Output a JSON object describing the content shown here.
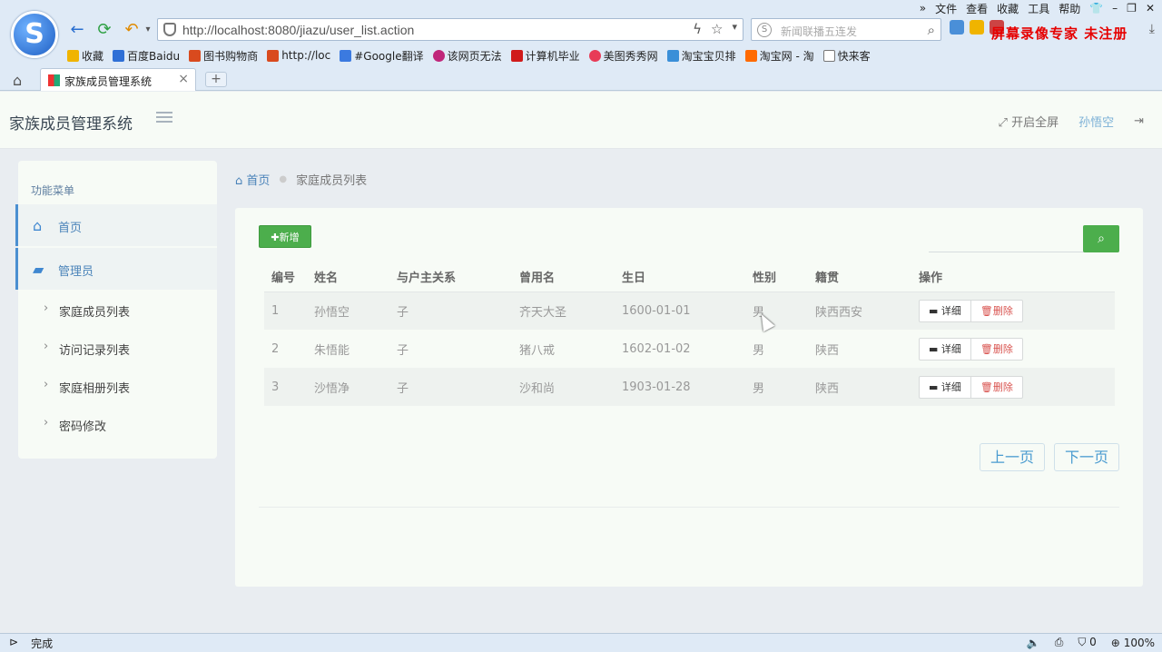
{
  "browser": {
    "menu": [
      "»",
      "文件",
      "查看",
      "收藏",
      "工具",
      "帮助"
    ],
    "url": "http://localhost:8080/jiazu/user_list.action",
    "search_placeholder": "新闻联播五连发",
    "watermark": "屏幕录像专家  未注册",
    "bookmarks": [
      {
        "label": "收藏",
        "color": "#f0b400"
      },
      {
        "label": "百度Baidu",
        "color": "#2f6fd6"
      },
      {
        "label": "图书购物商",
        "color": "#d94a1e"
      },
      {
        "label": "http://loc",
        "color": "#d94a1e"
      },
      {
        "label": "#Google翻译",
        "color": "#3b7ae0"
      },
      {
        "label": "该网页无法",
        "color": "#c0267a"
      },
      {
        "label": "计算机毕业",
        "color": "#d01b1b"
      },
      {
        "label": "美图秀秀网",
        "color": "#e83b57"
      },
      {
        "label": "淘宝宝贝排",
        "color": "#3a8fd8"
      },
      {
        "label": "淘宝网 - 淘",
        "color": "#ff6a00"
      },
      {
        "label": "快来客",
        "color": "#777777"
      }
    ],
    "tab_title": "家族成员管理系统",
    "status_text": "完成",
    "status_right": {
      "security": "0",
      "zoom": "100%"
    }
  },
  "header": {
    "title": "家族成员管理系统",
    "fullscreen": "开启全屏",
    "username": "孙悟空"
  },
  "sidebar": {
    "heading": "功能菜单",
    "items": [
      {
        "label": "首页",
        "icon": "home-icon"
      },
      {
        "label": "管理员",
        "icon": "folder-icon"
      }
    ],
    "sub_items": [
      "家庭成员列表",
      "访问记录列表",
      "家庭相册列表",
      "密码修改"
    ]
  },
  "breadcrumb": {
    "home": "首页",
    "current": "家庭成员列表"
  },
  "main": {
    "add_label": "新增",
    "search_value": "",
    "columns": [
      "编号",
      "姓名",
      "与户主关系",
      "曾用名",
      "生日",
      "性别",
      "籍贯",
      "操作"
    ],
    "rows": [
      {
        "id": "1",
        "name": "孙悟空",
        "relation": "子",
        "former_name": "齐天大圣",
        "birthday": "1600-01-01",
        "gender": "男",
        "hometown": "陕西西安"
      },
      {
        "id": "2",
        "name": "朱悟能",
        "relation": "子",
        "former_name": "猪八戒",
        "birthday": "1602-01-02",
        "gender": "男",
        "hometown": "陕西"
      },
      {
        "id": "3",
        "name": "沙悟净",
        "relation": "子",
        "former_name": "沙和尚",
        "birthday": "1903-01-28",
        "gender": "男",
        "hometown": "陕西"
      }
    ],
    "detail_label": "详细",
    "delete_label": "删除",
    "prev_label": "上一页",
    "next_label": "下一页"
  },
  "colors": {
    "accent_green": "#4cae4c",
    "accent_blue": "#4a83b9",
    "danger": "#d9534f"
  }
}
